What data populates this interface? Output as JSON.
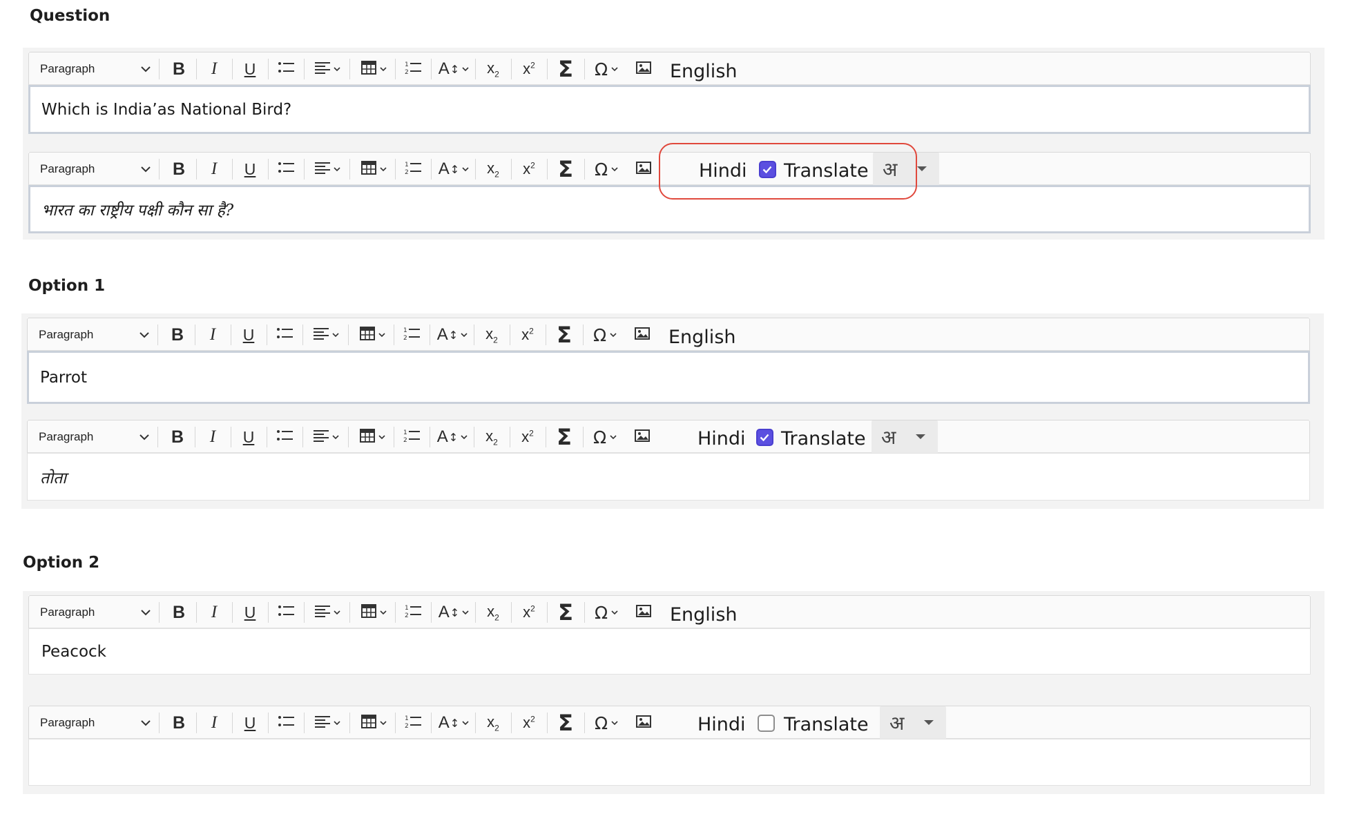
{
  "sections": {
    "question": "Question",
    "option1": "Option 1",
    "option2": "Option 2"
  },
  "toolbar": {
    "paragraph_label": "Paragraph",
    "bold": "B",
    "italic": "I",
    "underline": "U",
    "font_size": "A",
    "subscript_base": "x",
    "subscript_mark": "2",
    "superscript_base": "x",
    "superscript_mark": "2",
    "sigma": "Σ",
    "omega": "Ω"
  },
  "languages": {
    "english": "English",
    "hindi": "Hindi",
    "translate": "Translate",
    "ime_glyph": "अ"
  },
  "editors": {
    "question_en": "Which is India’as National Bird?",
    "question_hi": "भारत का राष्ट्रीय पक्षी कौन सा है?",
    "option1_en": "Parrot",
    "option1_hi": "तोता",
    "option2_en": "Peacock",
    "option2_hi": ""
  },
  "translate_state": {
    "question_hi": true,
    "option1_hi": true,
    "option2_hi": false
  },
  "colors": {
    "checkbox_accent": "#5b4fe0",
    "highlight": "#e0483c",
    "panel_bg": "#f3f3f3"
  }
}
